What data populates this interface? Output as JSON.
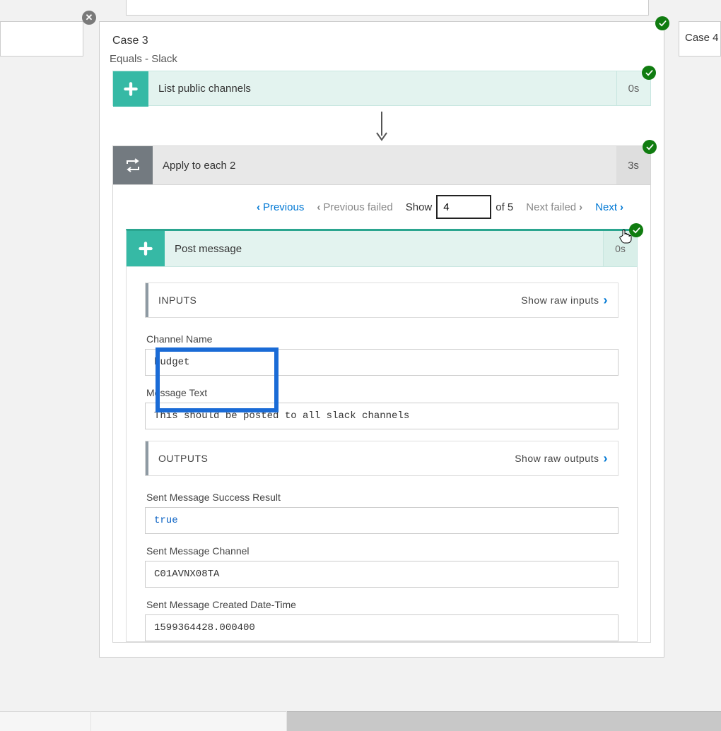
{
  "case4_label": "Case 4",
  "main": {
    "case_title": "Case 3",
    "equals_line": "Equals - Slack",
    "step1": {
      "title": "List public channels",
      "duration": "0s"
    },
    "apply": {
      "title": "Apply to each 2",
      "duration": "3s"
    },
    "pager": {
      "previous": "Previous",
      "previous_failed": "Previous failed",
      "show_label": "Show",
      "current": "4",
      "of_label": "of 5",
      "next_failed": "Next failed",
      "next": "Next"
    },
    "post": {
      "title": "Post message",
      "duration": "0s"
    },
    "inputs": {
      "header": "INPUTS",
      "raw_label": "Show raw inputs",
      "channel_name_label": "Channel Name",
      "channel_name_value": "budget",
      "message_text_label": "Message Text",
      "message_text_value": "This should be posted to all slack channels"
    },
    "outputs": {
      "header": "OUTPUTS",
      "raw_label": "Show raw outputs",
      "success_label": "Sent Message Success Result",
      "success_value": "true",
      "channel_label": "Sent Message Channel",
      "channel_value": "C01AVNX08TA",
      "created_label": "Sent Message Created Date-Time",
      "created_value": "1599364428.000400"
    }
  }
}
